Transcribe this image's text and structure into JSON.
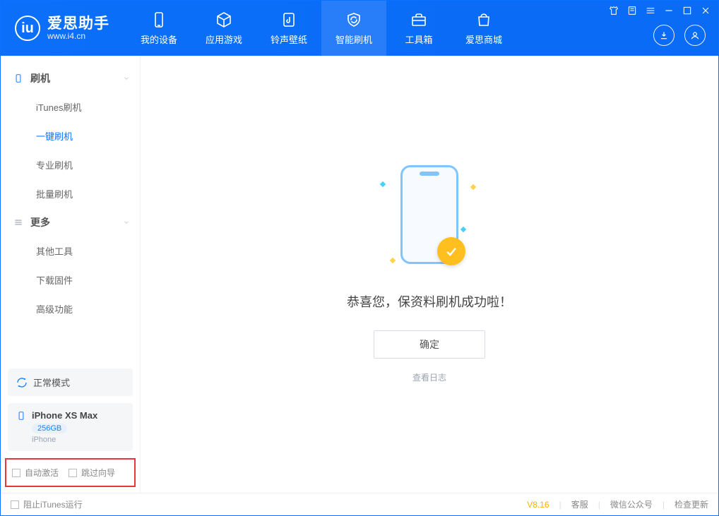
{
  "app": {
    "name_cn": "爱思助手",
    "url": "www.i4.cn"
  },
  "header": {
    "tabs": [
      {
        "label": "我的设备"
      },
      {
        "label": "应用游戏"
      },
      {
        "label": "铃声壁纸"
      },
      {
        "label": "智能刷机"
      },
      {
        "label": "工具箱"
      },
      {
        "label": "爱思商城"
      }
    ]
  },
  "sidebar": {
    "section1_title": "刷机",
    "section1_items": [
      {
        "label": "iTunes刷机"
      },
      {
        "label": "一键刷机"
      },
      {
        "label": "专业刷机"
      },
      {
        "label": "批量刷机"
      }
    ],
    "section2_title": "更多",
    "section2_items": [
      {
        "label": "其他工具"
      },
      {
        "label": "下载固件"
      },
      {
        "label": "高级功能"
      }
    ],
    "mode_label": "正常模式",
    "device": {
      "name": "iPhone XS Max",
      "storage": "256GB",
      "sub": "iPhone"
    },
    "checks": {
      "auto_activate": "自动激活",
      "skip_guide": "跳过向导"
    }
  },
  "main": {
    "success_text": "恭喜您，保资料刷机成功啦！",
    "ok_label": "确定",
    "log_link": "查看日志"
  },
  "statusbar": {
    "stop_itunes": "阻止iTunes运行",
    "version": "V8.16",
    "links": {
      "cs": "客服",
      "wechat": "微信公众号",
      "update": "检查更新"
    }
  }
}
